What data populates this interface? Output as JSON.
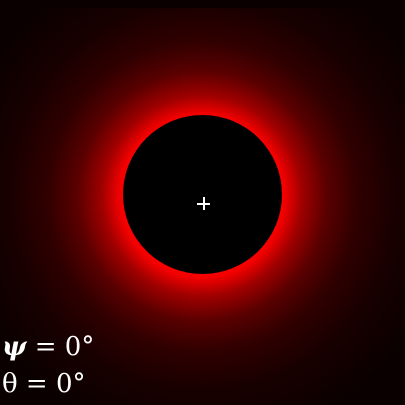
{
  "readouts": {
    "psi": {
      "symbol": "ψ",
      "text": " = 0°",
      "value_deg": 0
    },
    "theta": {
      "symbol": "θ",
      "text": " = 0°",
      "value_deg": 0
    }
  },
  "visual": {
    "disk_color": "#000000",
    "glow_color": "#ff0000",
    "background_color": "#000000",
    "crosshair_color": "#ffffff",
    "text_color": "#ffffff",
    "icons": [
      "crosshair-icon"
    ]
  }
}
